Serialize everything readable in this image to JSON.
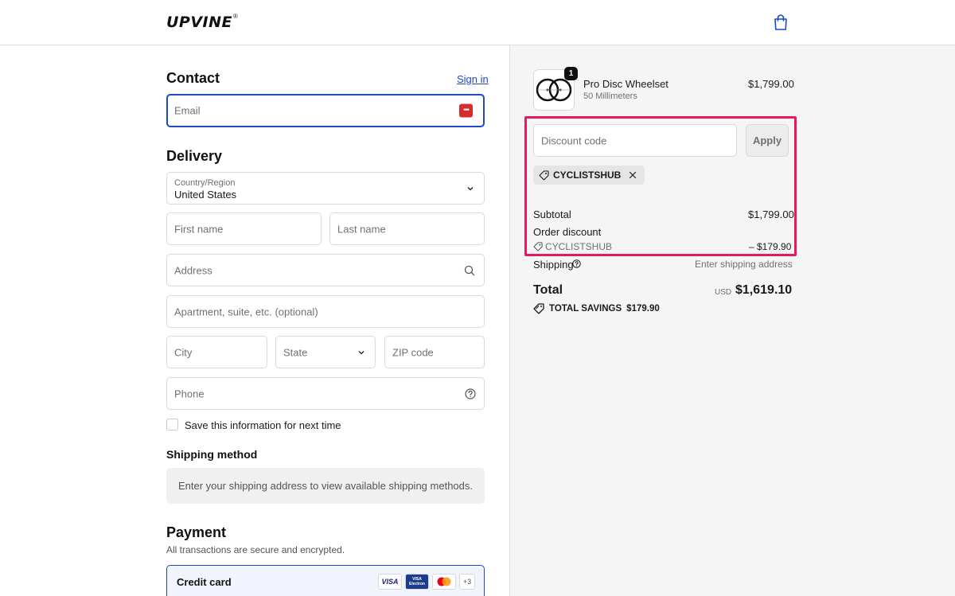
{
  "header": {
    "logo_text": "UPVINE",
    "logo_reg": "®",
    "cart_icon": "shopping-bag-icon"
  },
  "contact": {
    "title": "Contact",
    "sign_in": "Sign in",
    "email_placeholder": "Email"
  },
  "delivery": {
    "title": "Delivery",
    "country_label": "Country/Region",
    "country_value": "United States",
    "first_name": "First name",
    "last_name": "Last name",
    "address": "Address",
    "apartment": "Apartment, suite, etc. (optional)",
    "city": "City",
    "state": "State",
    "zip": "ZIP code",
    "phone": "Phone",
    "save_info": "Save this information for next time"
  },
  "shipping_method": {
    "title": "Shipping method",
    "message": "Enter your shipping address to view available shipping methods."
  },
  "payment": {
    "title": "Payment",
    "subtitle": "All transactions are secure and encrypted.",
    "method_label": "Credit card",
    "card_badges": [
      "VISA",
      "VISA Electron",
      "Mastercard",
      "+3"
    ]
  },
  "order": {
    "quantity": "1",
    "product_name": "Pro Disc Wheelset",
    "product_variant": "50 Millimeters",
    "product_price": "$1,799.00",
    "discount_placeholder": "Discount code",
    "apply_label": "Apply",
    "applied_code": "CYCLISTSHUB",
    "subtotal_label": "Subtotal",
    "subtotal_value": "$1,799.00",
    "order_discount_label": "Order discount",
    "order_discount_code": "CYCLISTSHUB",
    "order_discount_value": "– $179.90",
    "shipping_label": "Shipping",
    "shipping_value": "Enter shipping address",
    "total_label": "Total",
    "total_currency": "USD",
    "total_value": "$1,619.10",
    "savings_label": "TOTAL SAVINGS",
    "savings_value": "$179.90"
  },
  "colors": {
    "accent": "#1a48c9",
    "highlight": "#e6195f",
    "sidebar_bg": "#f5f5f5"
  }
}
